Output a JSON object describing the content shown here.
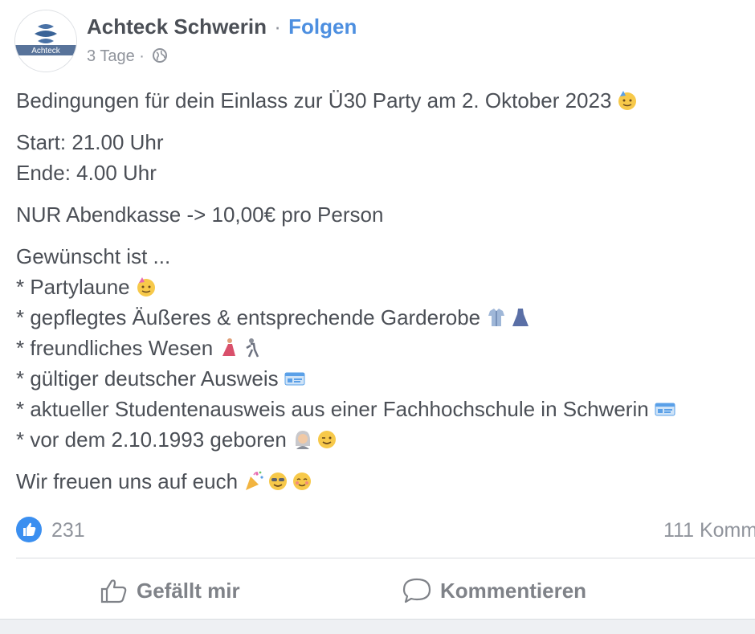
{
  "post": {
    "author": "Achteck Schwerin",
    "separator": "·",
    "follow_label": "Folgen",
    "time": "3 Tage",
    "meta_separator": "·",
    "avatar_text": "Achteck",
    "headline": "Bedingungen für dein Einlass zur Ü30 Party am 2. Oktober 2023",
    "start": "Start: 21.00 Uhr",
    "end": "Ende: 4.00 Uhr",
    "price": "NUR Abendkasse -> 10,00€ pro Person",
    "wish_title": "Gewünscht ist ...",
    "wishes": [
      "* Partylaune",
      "* gepflegtes Äußeres & entsprechende Garderobe",
      "* freundliches Wesen",
      "* gültiger deutscher Ausweis",
      "* aktueller Studentenausweis aus einer Fachhochschule in Schwerin",
      "* vor dem 2.10.1993 geboren"
    ],
    "closing": "Wir freuen uns auf euch"
  },
  "stats": {
    "likes": "231",
    "comments": "111 Komm"
  },
  "actions": {
    "like_label": "Gefällt mir",
    "comment_label": "Kommentieren"
  },
  "icons": {
    "avatar": "achteck-logo",
    "globe": "globe-icon",
    "like_badge": "thumbs-up-icon",
    "like_action": "thumbs-up-outline-icon",
    "comment_action": "speech-bubble-icon"
  },
  "colors": {
    "link": "#4d8fe0",
    "text": "#4b4f56",
    "muted": "#90949c",
    "like_blue": "#3b8ff0"
  }
}
